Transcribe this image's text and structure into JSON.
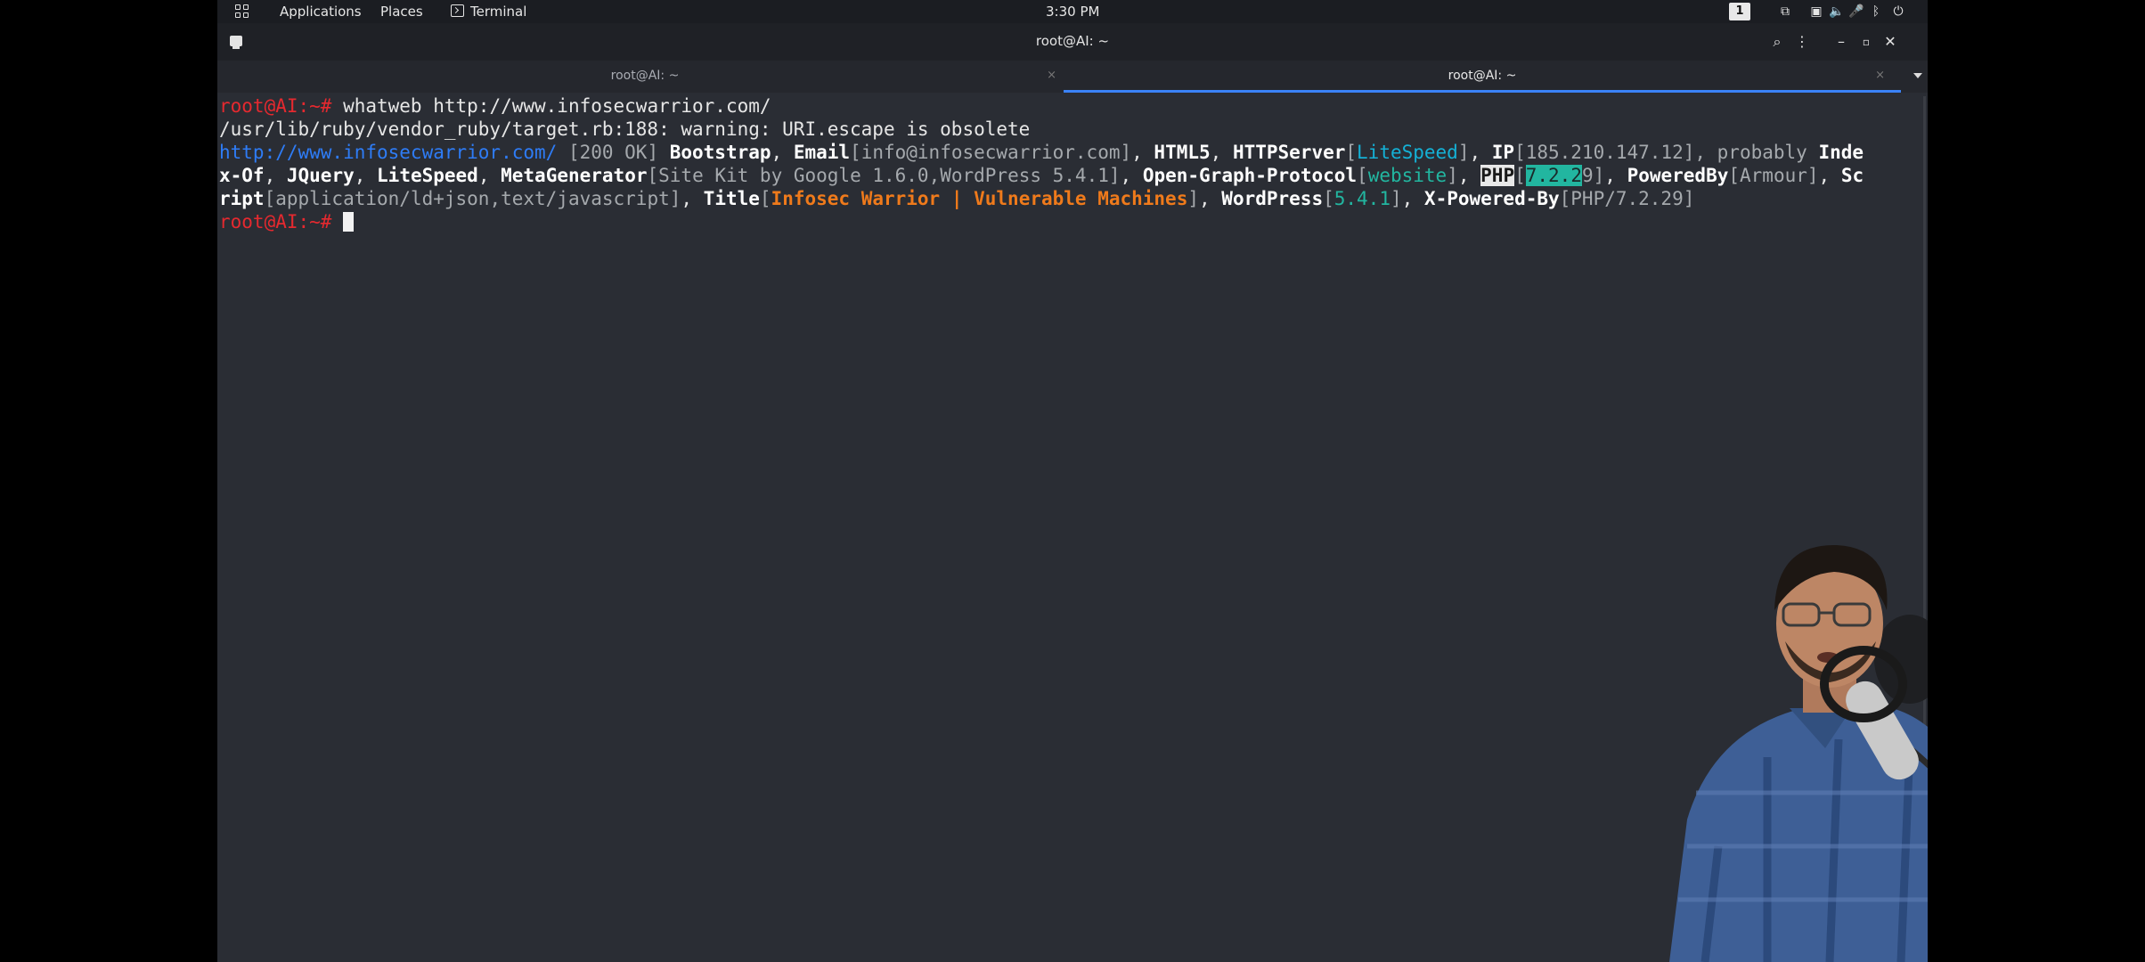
{
  "topbar": {
    "applications": "Applications",
    "places": "Places",
    "terminal": "Terminal",
    "clock": "3:30 PM",
    "workspace": "1"
  },
  "window": {
    "title": "root@AI: ~",
    "tabs": [
      {
        "label": "root@AI: ~",
        "active": false
      },
      {
        "label": "root@AI: ~",
        "active": true
      }
    ]
  },
  "terminal": {
    "prompt": "root@AI:~# ",
    "command": "whatweb http://www.infosecwarrior.com/",
    "warning": "/usr/lib/ruby/vendor_ruby/target.rb:188: warning: URI.escape is obsolete",
    "result": {
      "url": "http://www.infosecwarrior.com/",
      "status": " [200 OK] ",
      "bootstrap": "Bootstrap",
      "email_key": "Email",
      "email_val": "[info@infosecwarrior.com]",
      "html5": "HTML5",
      "httpserver_key": "HTTPServer",
      "httpserver_val": "LiteSpeed",
      "ip_key": "IP",
      "ip_val": "[185.210.147.12]",
      "probably": ", probably ",
      "index_a": "Inde",
      "index_b": "x-Of",
      "jquery": "JQuery",
      "litespeed": "LiteSpeed",
      "meta_key": "MetaGenerator",
      "meta_val": "[Site Kit by Google 1.6.0,WordPress 5.4.1]",
      "og_key": "Open-Graph-Protocol",
      "og_val": "website",
      "php_key": "PHP",
      "php_val_a": "7.2.2",
      "php_val_b": "9",
      "powered_key": "PoweredBy",
      "powered_val": "[Armour]",
      "script_a": "Sc",
      "script_b": "ript",
      "script_val": "[application/ld+json,text/javascript]",
      "title_key": "Title",
      "title_val": "Infosec Warrior | Vulnerable Machines",
      "wp_key": "WordPress",
      "wp_val": "5.4.1",
      "xpb_key": "X-Powered-By",
      "xpb_val": "[PHP/7.2.29]"
    }
  },
  "colors": {
    "prompt": "#e5292f",
    "link": "#2e7cf6",
    "accent_tab": "#3a82f7",
    "title_value": "#ef7a1b",
    "teal_value": "#22b6a0"
  }
}
